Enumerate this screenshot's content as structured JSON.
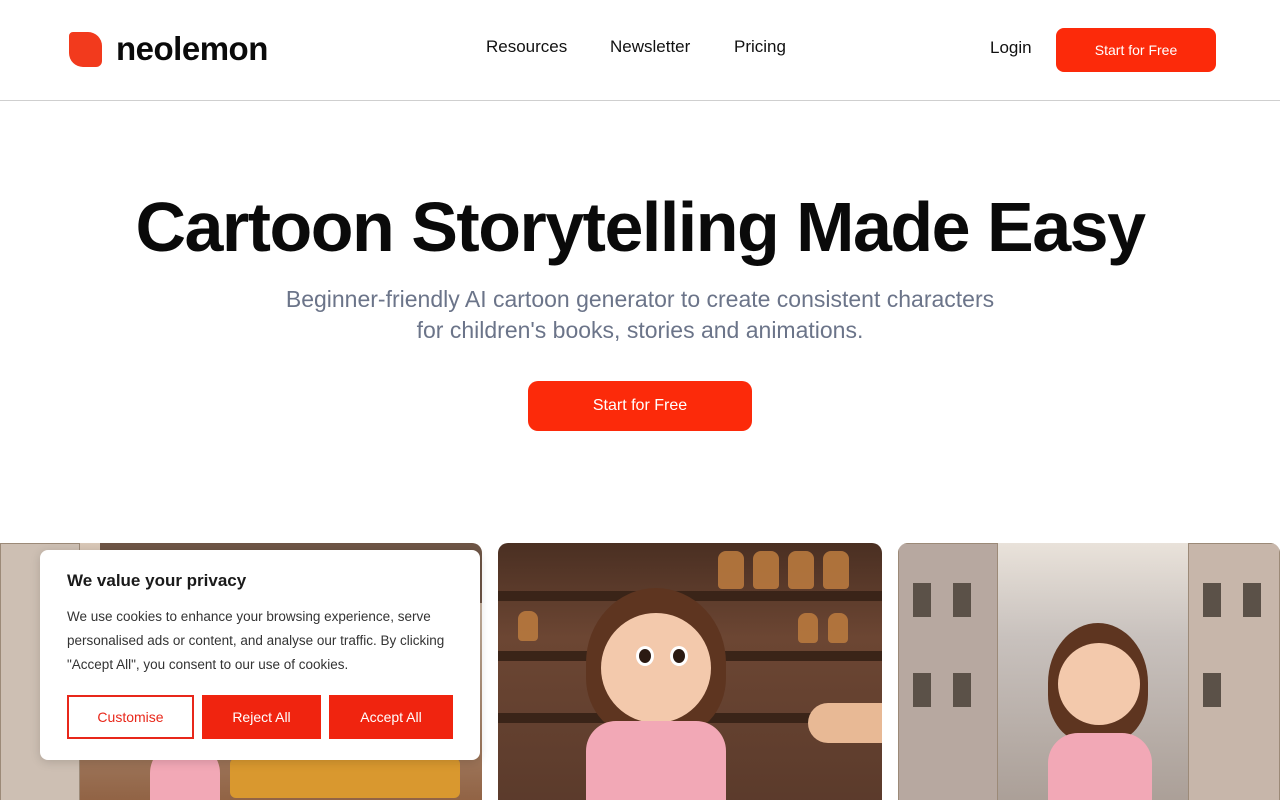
{
  "brand": {
    "name": "neolemon",
    "accent_color": "#fc2a0a"
  },
  "nav": {
    "items": [
      {
        "label": "Resources"
      },
      {
        "label": "Newsletter"
      },
      {
        "label": "Pricing"
      }
    ]
  },
  "header": {
    "login_label": "Login",
    "cta_label": "Start for Free"
  },
  "hero": {
    "title": "Cartoon Storytelling Made Easy",
    "subtitle_line1": "Beginner-friendly AI cartoon generator to create consistent characters",
    "subtitle_line2": "for children's books, stories and animations.",
    "cta_label": "Start for Free"
  },
  "cookie": {
    "title": "We value your privacy",
    "text": "We use cookies to enhance your browsing experience, serve personalised ads or content, and analyse our traffic. By clicking \"Accept All\", you consent to our use of cookies.",
    "customise_label": "Customise",
    "reject_label": "Reject All",
    "accept_label": "Accept All"
  },
  "gallery": {
    "images": [
      {
        "name": "girl-at-bakery-tray"
      },
      {
        "name": "girl-at-shop-counter"
      },
      {
        "name": "girl-eating-pastry-street"
      }
    ]
  }
}
